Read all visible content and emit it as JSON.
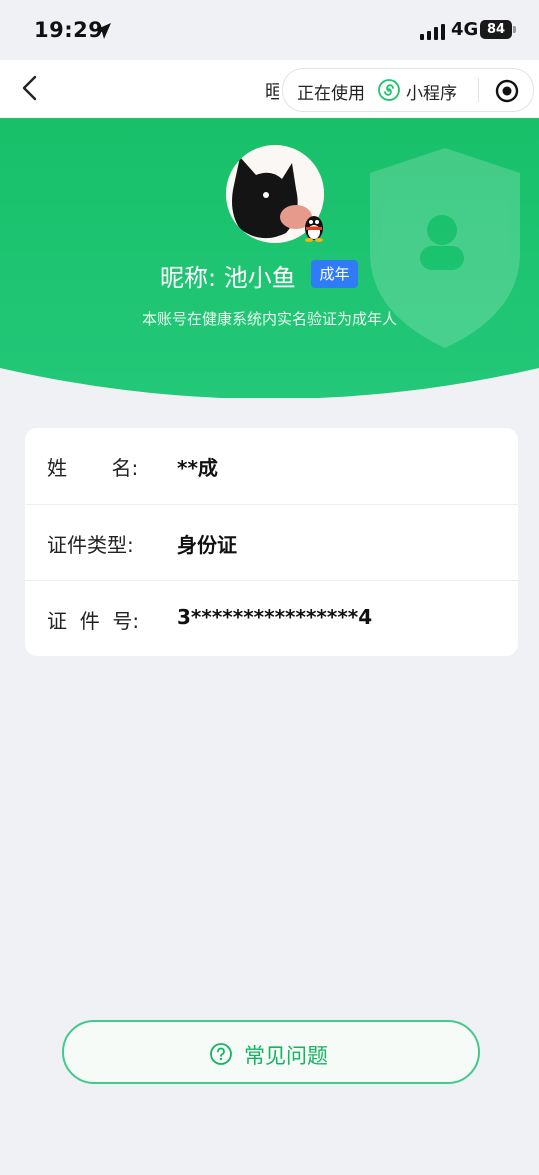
{
  "status_bar": {
    "time": "19:29",
    "network": "4G",
    "battery": "84"
  },
  "nav": {
    "title_peek": "晅",
    "capsule_text": "正在使用",
    "capsule_mp": "小程序"
  },
  "profile": {
    "nickname": "昵称: 池小鱼",
    "badge": "成年",
    "description": "本账号在健康系统内实名验证为成年人"
  },
  "info": {
    "rows": [
      {
        "label": "姓       名:",
        "value": "**成"
      },
      {
        "label": "证件类型:",
        "value": "身份证"
      },
      {
        "label": "证  件  号:",
        "value": "3****************4"
      }
    ]
  },
  "faq_button": {
    "label": "常见问题"
  },
  "colors": {
    "brand_green": "#1ec46e",
    "badge_blue": "#2f7cf6",
    "faq_green": "#15b463"
  }
}
